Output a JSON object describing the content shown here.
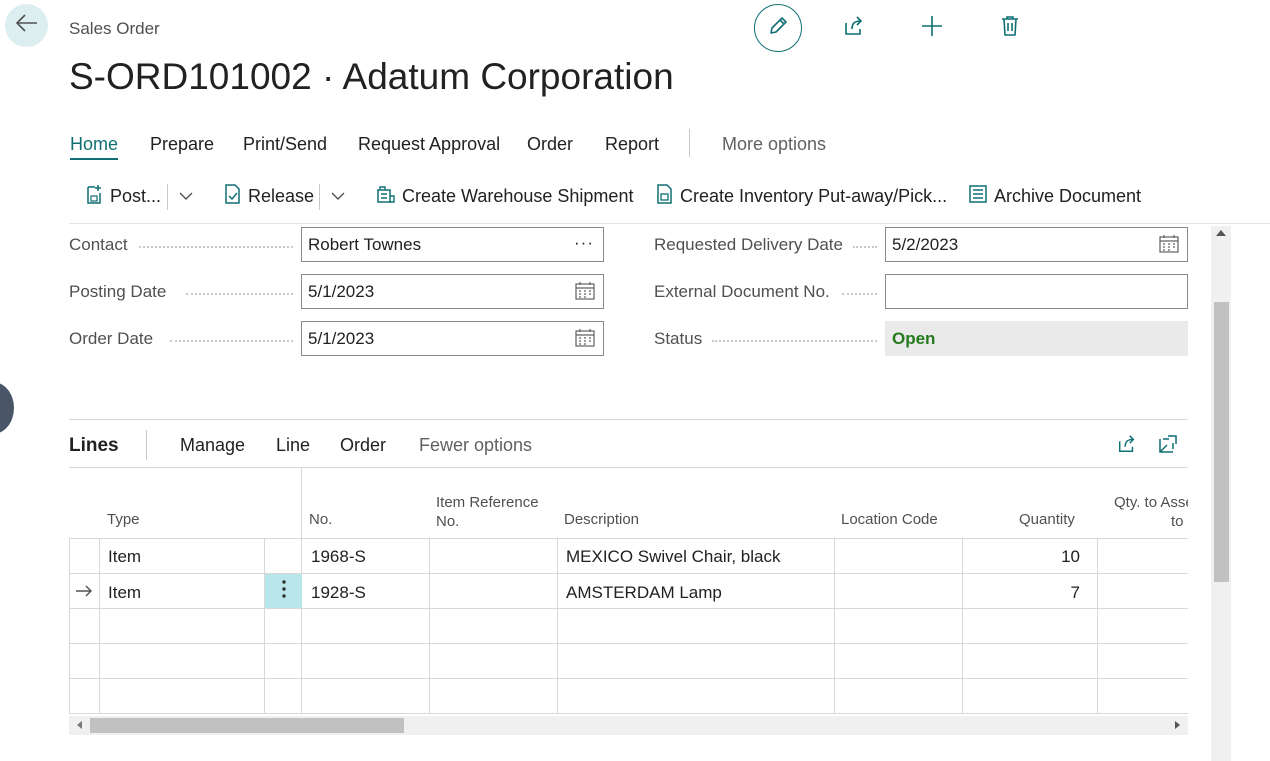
{
  "header": {
    "page_kind": "Sales Order",
    "title": "S-ORD101002 · Adatum Corporation"
  },
  "top_actions": [
    "edit-icon",
    "share-icon",
    "plus-icon",
    "trash-icon"
  ],
  "menu": {
    "items": [
      "Home",
      "Prepare",
      "Print/Send",
      "Request Approval",
      "Order",
      "Report"
    ],
    "active": "Home",
    "more": "More options"
  },
  "actions": {
    "post": "Post...",
    "release": "Release",
    "create_shipment": "Create Warehouse Shipment",
    "create_putaway": "Create Inventory Put-away/Pick...",
    "archive": "Archive Document"
  },
  "fields": {
    "contact": {
      "label": "Contact",
      "value": "Robert Townes"
    },
    "posting_date": {
      "label": "Posting Date",
      "value": "5/1/2023"
    },
    "order_date": {
      "label": "Order Date",
      "value": "5/1/2023"
    },
    "requested_delivery_date": {
      "label": "Requested Delivery Date",
      "value": "5/2/2023"
    },
    "external_document_no": {
      "label": "External Document No.",
      "value": ""
    },
    "status": {
      "label": "Status",
      "value": "Open"
    }
  },
  "lines": {
    "title": "Lines",
    "menu": [
      "Manage",
      "Line",
      "Order"
    ],
    "more": "Fewer options",
    "columns": {
      "type": "Type",
      "no": "No.",
      "item_ref_1": "Item Reference",
      "item_ref_2": "No.",
      "description": "Description",
      "location": "Location Code",
      "quantity": "Quantity",
      "qty_assemble_1": "Qty. to Asse",
      "qty_assemble_2": "to"
    },
    "rows": [
      {
        "type": "Item",
        "no": "1968-S",
        "description": "MEXICO Swivel Chair, black",
        "location": "",
        "quantity": "10"
      },
      {
        "type": "Item",
        "no": "1928-S",
        "description": "AMSTERDAM Lamp",
        "location": "",
        "quantity": "7"
      }
    ]
  },
  "colors": {
    "accent": "#0f6f73",
    "status_open": "#257a1e",
    "selected_cell": "#b9e6ea"
  }
}
